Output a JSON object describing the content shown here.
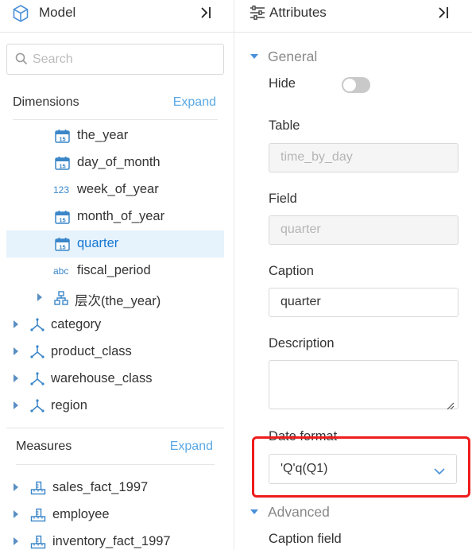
{
  "model": {
    "title": "Model",
    "search_placeholder": "Search",
    "dimensions": {
      "label": "Dimensions",
      "expand_label": "Expand",
      "children": [
        {
          "label": "the_year",
          "type": "date"
        },
        {
          "label": "day_of_month",
          "type": "date"
        },
        {
          "label": "week_of_year",
          "type": "number",
          "type_text": "123"
        },
        {
          "label": "month_of_year",
          "type": "date"
        },
        {
          "label": "quarter",
          "type": "date",
          "selected": true
        },
        {
          "label": "fiscal_period",
          "type": "text",
          "type_text": "abc"
        },
        {
          "label": "层次(the_year)",
          "type": "hierarchy"
        }
      ],
      "groups": [
        "category",
        "product_class",
        "warehouse_class",
        "region"
      ]
    },
    "measures": {
      "label": "Measures",
      "expand_label": "Expand",
      "items": [
        "sales_fact_1997",
        "employee",
        "inventory_fact_1997"
      ]
    }
  },
  "attributes": {
    "title": "Attributes",
    "general_label": "General",
    "hide_label": "Hide",
    "hide_value": false,
    "table_label": "Table",
    "table_value": "time_by_day",
    "field_label": "Field",
    "field_value": "quarter",
    "caption_label": "Caption",
    "caption_value": "quarter",
    "description_label": "Description",
    "description_value": "",
    "date_format_label": "Date format",
    "date_format_value": "'Q'q(Q1)",
    "advanced_label": "Advanced",
    "caption_field_label": "Caption field"
  },
  "colors": {
    "accent": "#1677d2",
    "link": "#5aa9e6",
    "selected_bg": "#e6f2fc",
    "highlight_box": "#ee1c1c"
  }
}
